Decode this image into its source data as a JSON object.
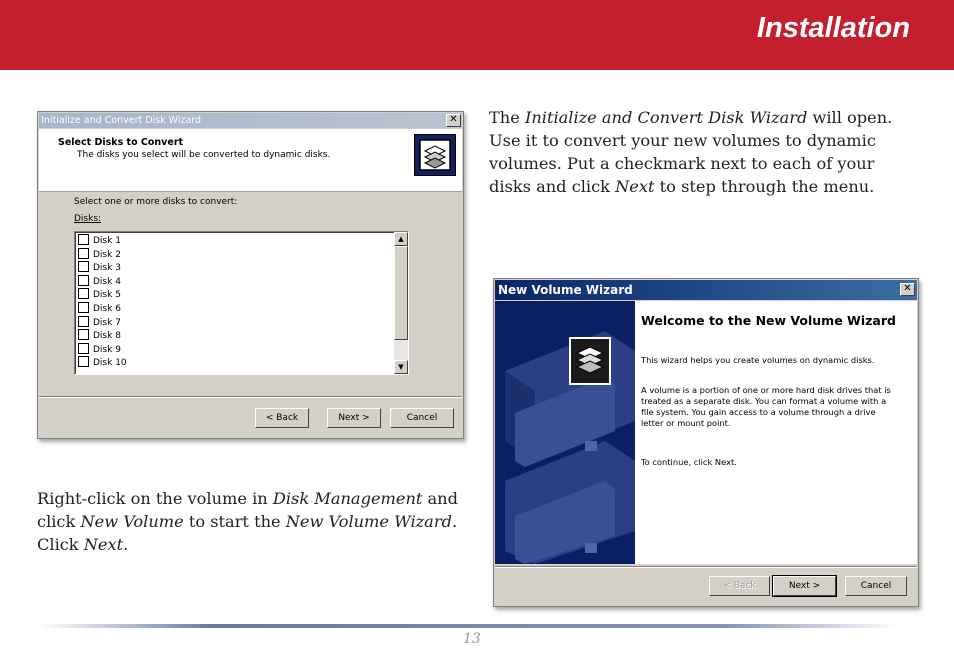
{
  "header": {
    "title": "Installation"
  },
  "dialog1": {
    "title": "Initialize and Convert Disk Wizard",
    "heading": "Select Disks to Convert",
    "subheading": "The disks you select will be converted to dynamic disks.",
    "instruction": "Select one or more disks to convert:",
    "list_label": "Disks:",
    "disks": [
      "Disk 1",
      "Disk 2",
      "Disk 3",
      "Disk 4",
      "Disk 5",
      "Disk 6",
      "Disk 7",
      "Disk 8",
      "Disk 9",
      "Disk 10"
    ],
    "back_label": "< Back",
    "next_label": "Next >",
    "cancel_label": "Cancel"
  },
  "text_top": {
    "p1": "The ",
    "em1": "Initialize and Convert Disk Wizard",
    "p2": " will open.  Use it to convert your new volumes to dynamic volumes.  Put a checkmark next to each of your disks and click ",
    "em2": "Next",
    "p3": " to step through the menu."
  },
  "text_bottom": {
    "p1": "Right-click on the volume in ",
    "em1": "Disk Management",
    "p2": " and click ",
    "em2": "New Volume",
    "p3": " to start the ",
    "em3": "New Volume Wizard",
    "p4": ".  Click ",
    "em4": "Next",
    "p5": "."
  },
  "dialog2": {
    "title": "New Volume Wizard",
    "welcome": "Welcome to the New Volume Wizard",
    "para1": "This wizard helps you create volumes on dynamic disks.",
    "para2": "A volume is a portion of one or more hard disk drives that is treated as a separate disk. You can format a volume with a file system. You gain access to a volume through a drive letter or mount point.",
    "para3": "To continue, click Next.",
    "back_label": "< Back",
    "next_label": "Next >",
    "cancel_label": "Cancel"
  },
  "page_number": "13"
}
